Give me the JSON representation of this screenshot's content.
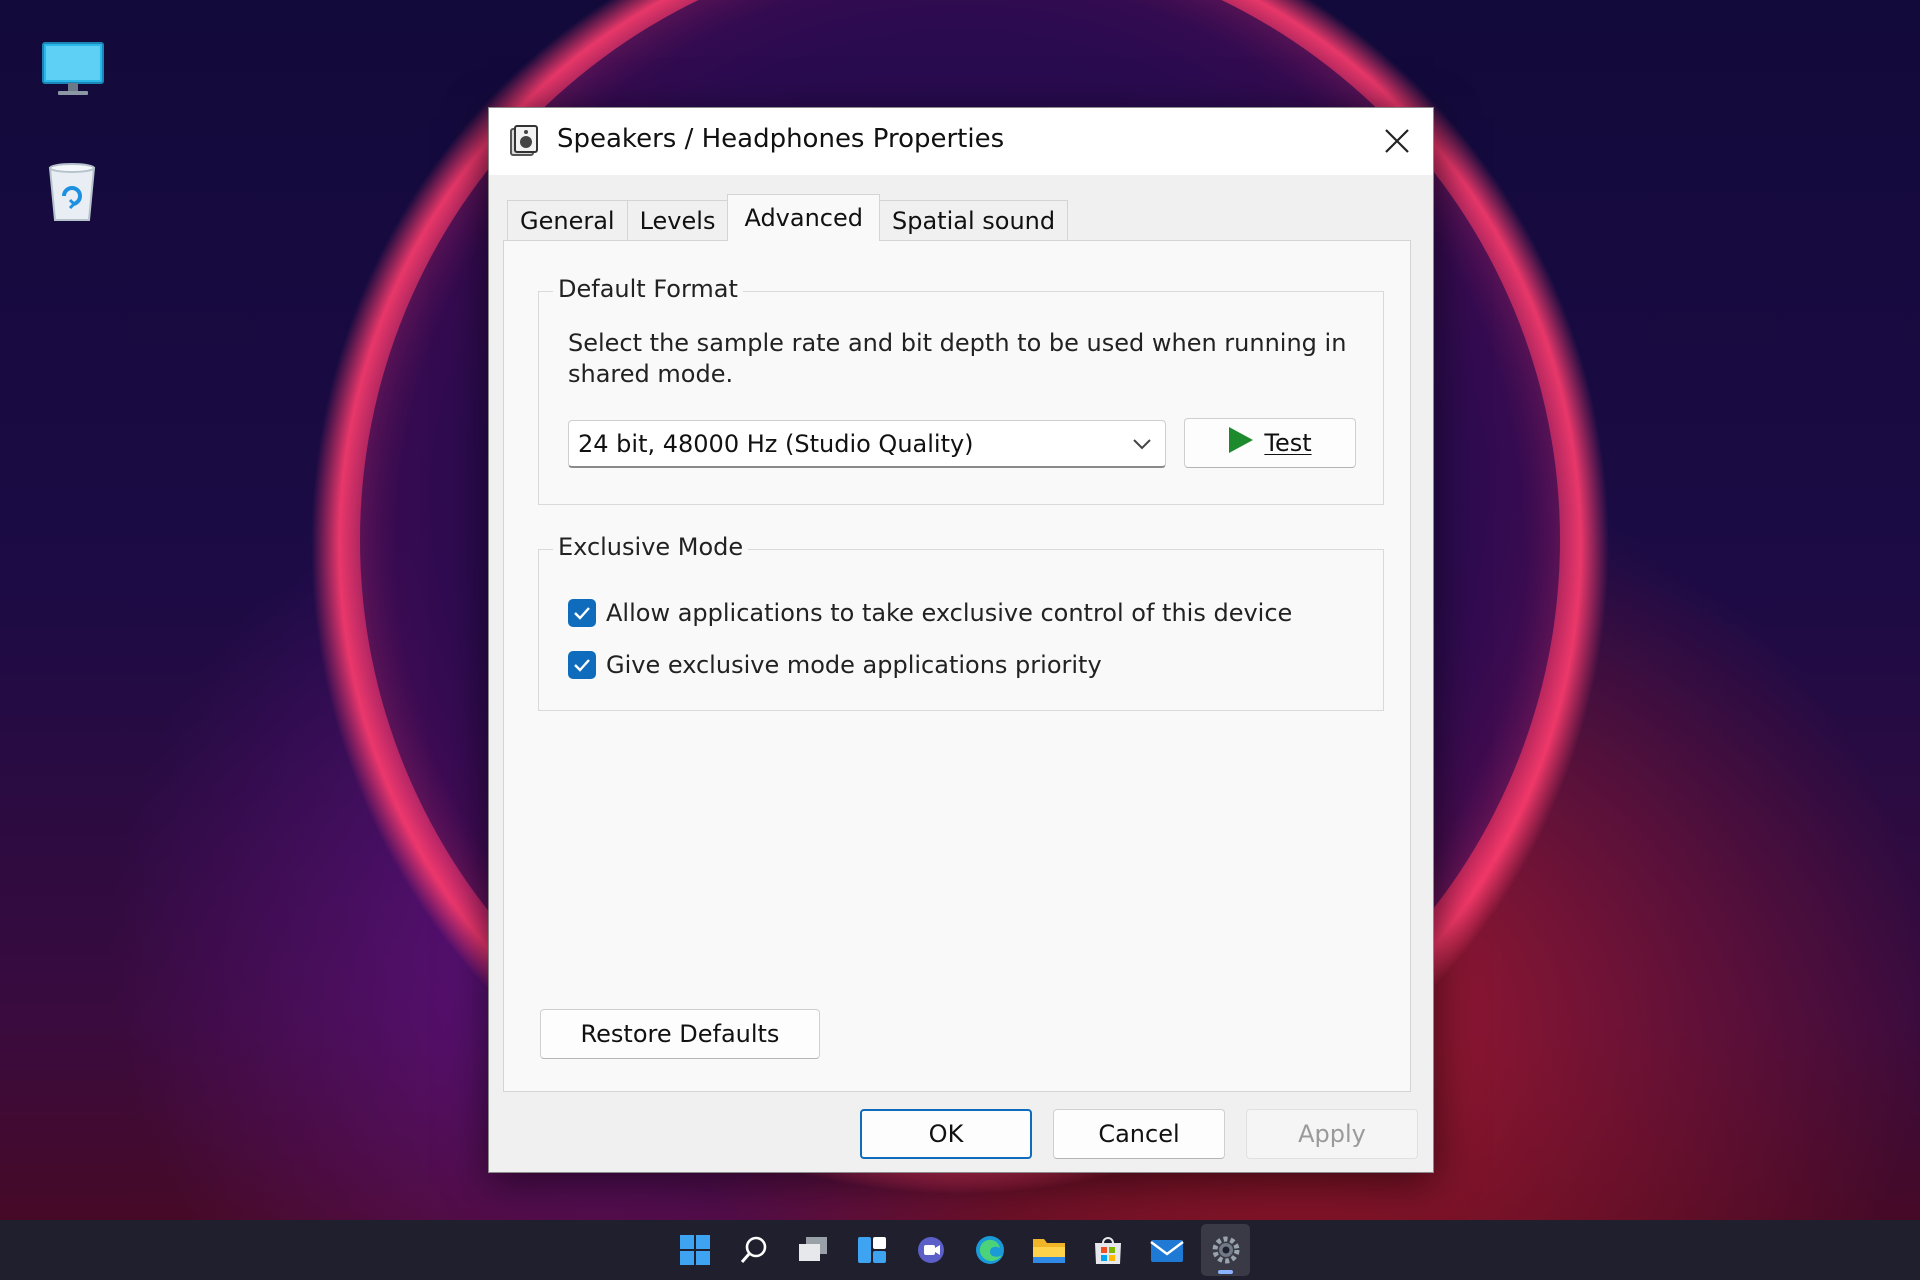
{
  "desktop": {
    "icons": [
      "this-pc-icon",
      "recycle-bin-icon"
    ]
  },
  "dialog": {
    "title": "Speakers / Headphones Properties",
    "tabs": [
      {
        "label": "General"
      },
      {
        "label": "Levels"
      },
      {
        "label": "Advanced"
      },
      {
        "label": "Spatial sound"
      }
    ],
    "active_tab": "Advanced",
    "default_format": {
      "legend": "Default Format",
      "description": "Select the sample rate and bit depth to be used when running in shared mode.",
      "selected_format": "24 bit, 48000 Hz (Studio Quality)",
      "test_label": "Test"
    },
    "exclusive_mode": {
      "legend": "Exclusive Mode",
      "options": [
        {
          "label": "Allow applications to take exclusive control of this device",
          "checked": true
        },
        {
          "label": "Give exclusive mode applications priority",
          "checked": true
        }
      ]
    },
    "restore_defaults_label": "Restore Defaults",
    "buttons": {
      "ok": "OK",
      "cancel": "Cancel",
      "apply": "Apply"
    }
  },
  "taskbar": {
    "items": [
      "start-icon",
      "search-icon",
      "task-view-icon",
      "widgets-icon",
      "chat-icon",
      "edge-icon",
      "file-explorer-icon",
      "store-icon",
      "mail-icon",
      "settings-icon"
    ],
    "active_item": "settings-icon"
  },
  "colors": {
    "accent": "#0f6cbd",
    "play": "#1e8a2e"
  }
}
